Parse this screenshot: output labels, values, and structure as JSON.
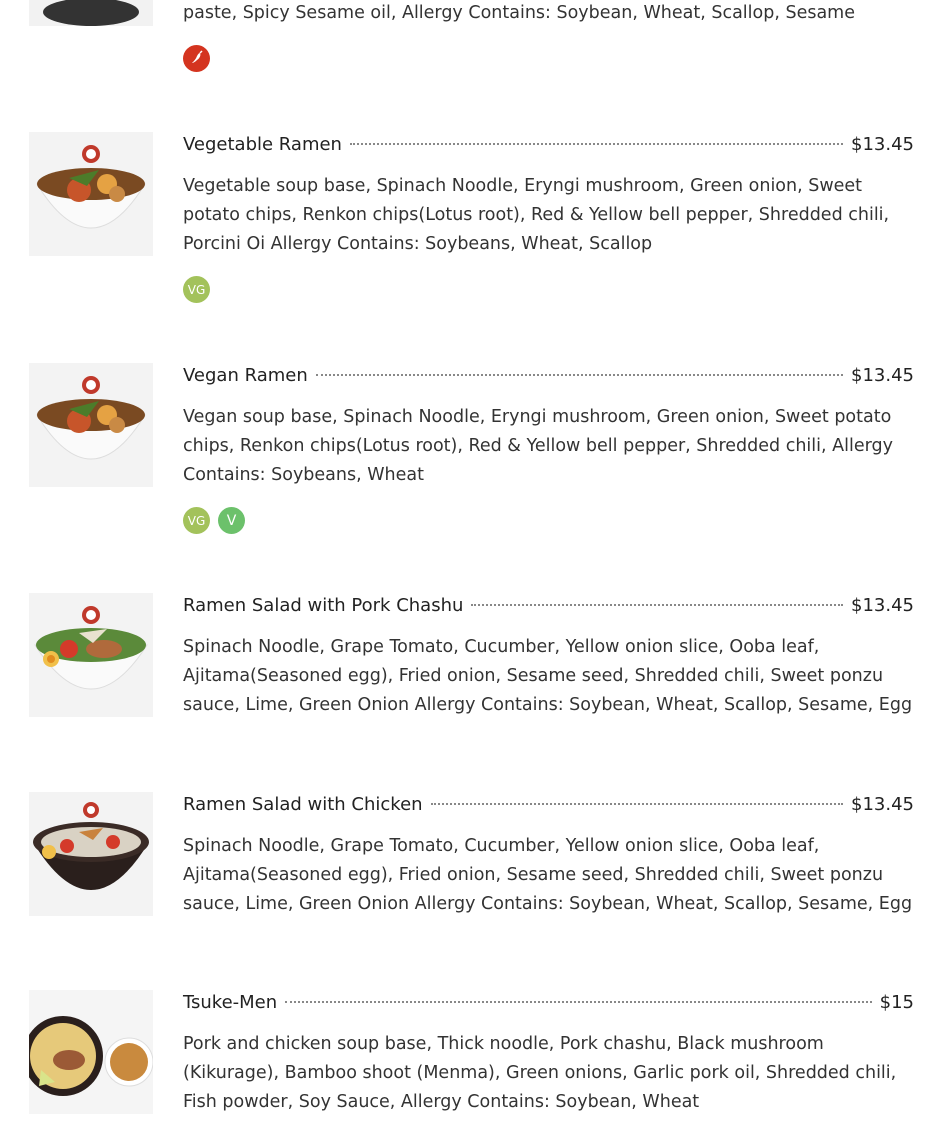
{
  "top_fragment": {
    "desc": "paste, Spicy Sesame oil, Allergy Contains: Soybean, Wheat, Scallop, Sesame",
    "icons": [
      "spicy-icon"
    ]
  },
  "items": [
    {
      "name": "Vegetable Ramen",
      "price": "$13.45",
      "desc": "Vegetable soup base, Spinach Noodle, Eryngi mushroom, Green onion, Sweet potato chips, Renkon chips(Lotus root), Red & Yellow bell pepper, Shredded chili, Porcini Oi Allergy Contains: Soybeans, Wheat, Scallop",
      "badges": [
        "VG"
      ]
    },
    {
      "name": "Vegan Ramen",
      "price": "$13.45",
      "desc": "Vegan soup base, Spinach Noodle, Eryngi mushroom, Green onion, Sweet potato chips, Renkon chips(Lotus root), Red & Yellow bell pepper, Shredded chili, Allergy Contains: Soybeans, Wheat",
      "badges": [
        "VG",
        "V"
      ]
    },
    {
      "name": "Ramen Salad with Pork Chashu",
      "price": "$13.45",
      "desc": "Spinach Noodle, Grape Tomato, Cucumber, Yellow onion slice, Ooba leaf, Ajitama(Seasoned egg), Fried onion, Sesame seed, Shredded chili, Sweet ponzu sauce, Lime, Green Onion Allergy Contains: Soybean, Wheat, Scallop, Sesame, Egg"
    },
    {
      "name": "Ramen Salad with Chicken",
      "price": "$13.45",
      "desc": "Spinach Noodle, Grape Tomato, Cucumber, Yellow onion slice, Ooba leaf, Ajitama(Seasoned egg), Fried onion, Sesame seed, Shredded chili, Sweet ponzu sauce, Lime, Green Onion Allergy Contains: Soybean, Wheat, Scallop, Sesame, Egg"
    },
    {
      "name": "Tsuke-Men",
      "price": "$15",
      "desc": "Pork and chicken soup base, Thick noodle, Pork chashu, Black mushroom (Kikurage), Bamboo shoot (Menma), Green onions, Garlic pork oil, Shredded chili, Fish powder, Soy Sauce, Allergy Contains: Soybean, Wheat"
    }
  ],
  "colors": {
    "vg_badge": "#a3c25b",
    "v_badge": "#6cc16b",
    "spicy_badge": "#d4341f"
  }
}
